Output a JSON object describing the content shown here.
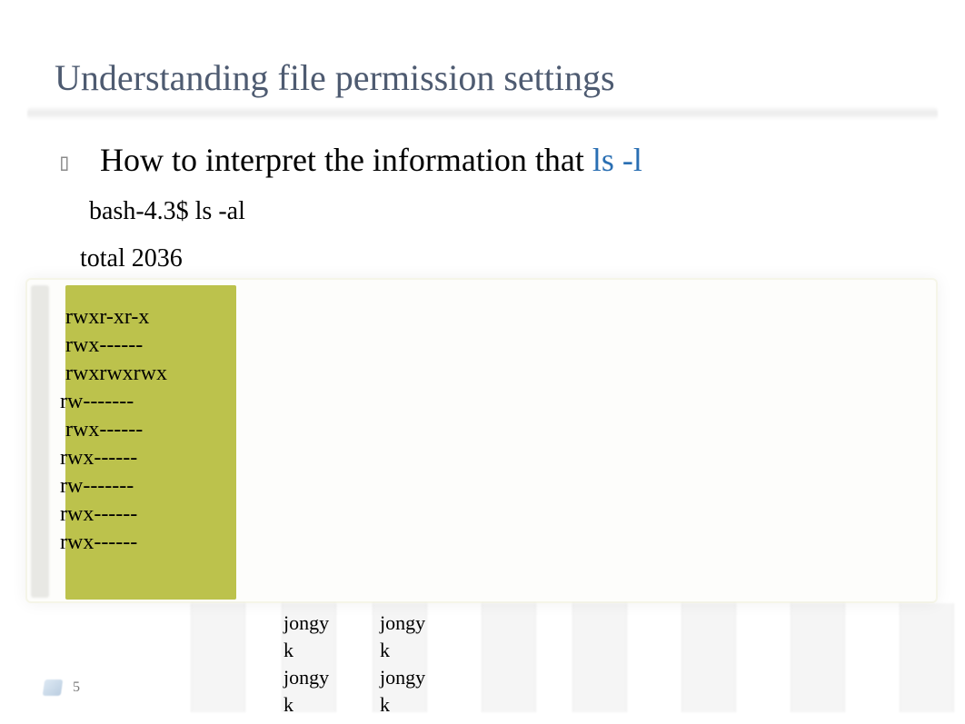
{
  "title": "Understanding file permission settings",
  "bullet": {
    "prefix": "How to interpret the information that ",
    "command": "ls -l"
  },
  "prompt_line": "bash-4.3$ ls -al",
  "total_line": "total 2036",
  "permissions": [
    " rwxr-xr-x",
    " rwx------",
    " rwxrwxrwx",
    "rw-------",
    " rwx------",
    "rwx------",
    "rw-------",
    "rwx------",
    "rwx------"
  ],
  "owners_col1": [
    "jongy",
    "k",
    "jongy",
    "k"
  ],
  "owners_col2": [
    "jongy",
    "k",
    "jongy",
    "k"
  ],
  "page_number": "5",
  "faint_col_lefts": [
    180,
    280,
    380,
    500,
    600,
    720,
    840,
    960
  ]
}
